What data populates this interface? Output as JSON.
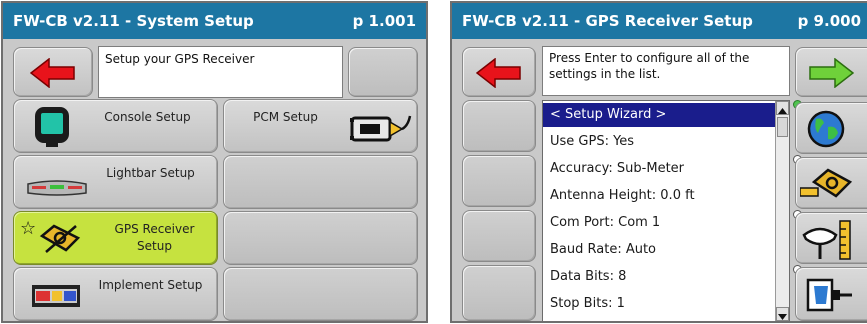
{
  "left_screen": {
    "title": "FW-CB v2.11 - System Setup",
    "page": "p 1.001",
    "message": "Setup your GPS Receiver",
    "buttons": {
      "console": "Console Setup",
      "pcm": "PCM Setup",
      "lightbar": "Lightbar Setup",
      "gps_line1": "GPS Receiver",
      "gps_line2": "Setup",
      "implement": "Implement Setup"
    },
    "icons": {
      "back": "red-left-arrow-icon",
      "console": "console-display-icon",
      "pcm": "pcm-module-icon",
      "lightbar": "lightbar-icon",
      "gps": "gps-receiver-icon",
      "implement": "implement-icon"
    },
    "colors": {
      "title_bar": "#1d76a3",
      "selected_button": "#c6e23f",
      "back_arrow": "#e8131b"
    }
  },
  "right_screen": {
    "title": "FW-CB v2.11 - GPS Receiver Setup",
    "page": "p 9.000",
    "message": "Press Enter to configure all of the settings in the list.",
    "list": {
      "items": [
        "< Setup Wizard >",
        "Use GPS: Yes",
        "Accuracy: Sub-Meter",
        "Antenna Height: 0.0 ft",
        "Com Port: Com 1",
        "Baud Rate: Auto",
        "Data Bits: 8",
        "Stop Bits: 1"
      ],
      "selected_index": 0
    },
    "side_icons": {
      "next": "green-right-arrow-icon",
      "globe": "globe-icon",
      "gps": "gps-receiver-icon",
      "antenna_height": "antenna-height-icon",
      "com_port": "com-port-connector-icon"
    },
    "colors": {
      "list_selection": "#1a1d8c",
      "next_arrow": "#6fd13a"
    }
  }
}
